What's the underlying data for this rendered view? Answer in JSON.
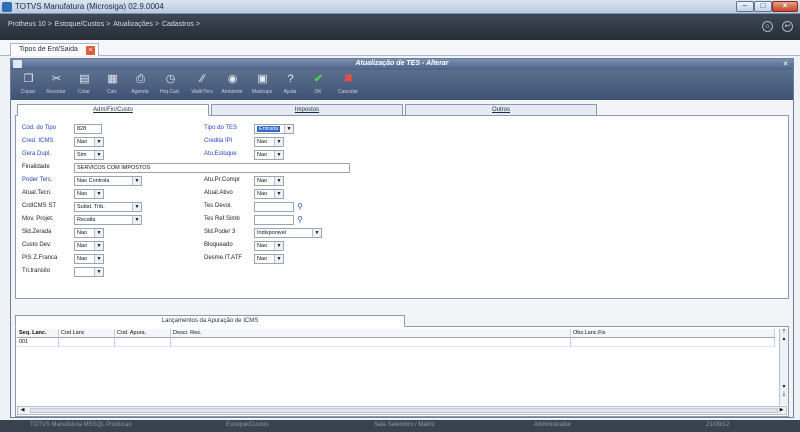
{
  "window": {
    "title": "TOTVS Manufatura (Microsiga) 02.9.0004"
  },
  "menubar": {
    "items": [
      {
        "label": "Protheus 10 >"
      },
      {
        "label": "Estoque/Custos >"
      },
      {
        "label": "Atualizações >"
      },
      {
        "label": "Cadastros >"
      }
    ]
  },
  "doc_tab": {
    "label": "Tipos de Ent/Saida"
  },
  "dialog": {
    "title": "Atualização de TES - Alterar"
  },
  "toolbar": {
    "buttons": [
      {
        "label": "Copiar",
        "icon": "copy-icon"
      },
      {
        "label": "Recortar",
        "icon": "scissors-icon"
      },
      {
        "label": "Colar",
        "icon": "paste-icon"
      },
      {
        "label": "Calc",
        "icon": "calculator-icon"
      },
      {
        "label": "Agenda",
        "icon": "printer-icon"
      },
      {
        "label": "Hrq.Cad.",
        "icon": "history-icon"
      },
      {
        "label": "WalkThru",
        "icon": "footprints-icon"
      },
      {
        "label": "Ambiente",
        "icon": "globe-icon"
      },
      {
        "label": "Mashups",
        "icon": "mashup-icon"
      },
      {
        "label": "Ajuda",
        "icon": "help-icon"
      },
      {
        "label": "OK",
        "icon": "check-icon"
      },
      {
        "label": "Cancelar",
        "icon": "cancel-icon"
      }
    ]
  },
  "folders": [
    {
      "label": "Adm/Fin/Custo"
    },
    {
      "label": "Impostos"
    },
    {
      "label": "Outros"
    }
  ],
  "form": {
    "cod_tipo": {
      "label": "Cod. do Tipo",
      "value": "828"
    },
    "tipo_tes": {
      "label": "Tipo do TES",
      "value": "Entrada"
    },
    "cred_icms": {
      "label": "Cred. ICMS",
      "value": "Nao"
    },
    "credita_ipi": {
      "label": "Credita IPI",
      "value": "Nao"
    },
    "gera_dupl": {
      "label": "Gera Dupl.",
      "value": "Sim"
    },
    "atu_estoque": {
      "label": "Atu.Estoque",
      "value": "Nao"
    },
    "finalidade": {
      "label": "Finalidade",
      "value": "SERVICOS COM IMPOSTOS"
    },
    "poder_terc": {
      "label": "Poder Terc.",
      "value": "Nao Controla"
    },
    "atu_pr_compr": {
      "label": "Atu.Pr.Compr",
      "value": "Nao"
    },
    "atual_tecn": {
      "label": "Atual.Tecn.",
      "value": "Nao"
    },
    "atual_ativo": {
      "label": "Atual.Ativo",
      "value": "Nao"
    },
    "crd_icms_st": {
      "label": "CrdICMS ST",
      "value": "Subst. Trib."
    },
    "tes_devol": {
      "label": "Tes Devol.",
      "value": ""
    },
    "mov_projet": {
      "label": "Mov. Projet.",
      "value": "Recalla"
    },
    "tes_ref_simb": {
      "label": "Tes Ref.Simb",
      "value": ""
    },
    "sld_zerada": {
      "label": "Sld.Zerada",
      "value": "Nao"
    },
    "sld_poder3": {
      "label": "Sld.Poder 3",
      "value": "Indisponivel"
    },
    "custo_dev": {
      "label": "Custo Dev.",
      "value": "Nao"
    },
    "bloqueado": {
      "label": "Bloqueado",
      "value": "Nao"
    },
    "pis_z_franca": {
      "label": "PIS Z.Franca",
      "value": "Nao"
    },
    "desme_it_atf": {
      "label": "Desme.IT.ATF",
      "value": "Nao"
    },
    "tri_transito": {
      "label": "Tri.transito",
      "value": ""
    }
  },
  "grid": {
    "tab_label": "Lançamentos da Apuração de ICMS",
    "columns": [
      "Seq. Lanc.",
      "Cod Lanc",
      "Cod. Apura.",
      "Descr. Res.",
      "Obs.Lanc.Fis"
    ],
    "rows": [
      [
        "001",
        "",
        "",
        "",
        ""
      ]
    ]
  },
  "status": {
    "items": [
      "TOTVS Manufatura MSSQL Producao",
      "Estoque/Custos",
      "Sala Selembro / Matriz",
      "Administrador",
      "21/09/12"
    ]
  }
}
